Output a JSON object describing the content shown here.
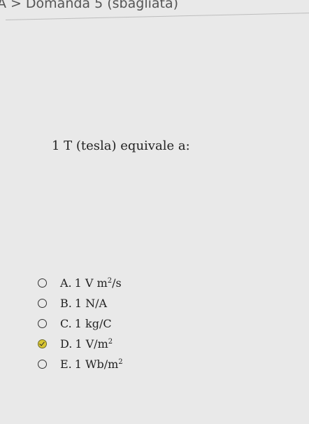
{
  "header": {
    "breadcrumb_start": "A",
    "separator": ">",
    "title": "Domanda 5 (sbagliata)"
  },
  "question": {
    "text": "1 T (tesla) equivale a:"
  },
  "options": [
    {
      "letter": "A.",
      "value": "1",
      "unit": "V m",
      "exp": "2",
      "suffix": "/s",
      "selected": false
    },
    {
      "letter": "B.",
      "value": "1",
      "unit": "N/A",
      "exp": "",
      "suffix": "",
      "selected": false
    },
    {
      "letter": "C.",
      "value": "1",
      "unit": "kg/C",
      "exp": "",
      "suffix": "",
      "selected": false
    },
    {
      "letter": "D.",
      "value": "1",
      "unit": "V/m",
      "exp": "2",
      "suffix": "",
      "selected": true
    },
    {
      "letter": "E.",
      "value": "1",
      "unit": "Wb/m",
      "exp": "2",
      "suffix": "",
      "selected": false
    }
  ],
  "colors": {
    "selected_radio": "#d9c632"
  }
}
